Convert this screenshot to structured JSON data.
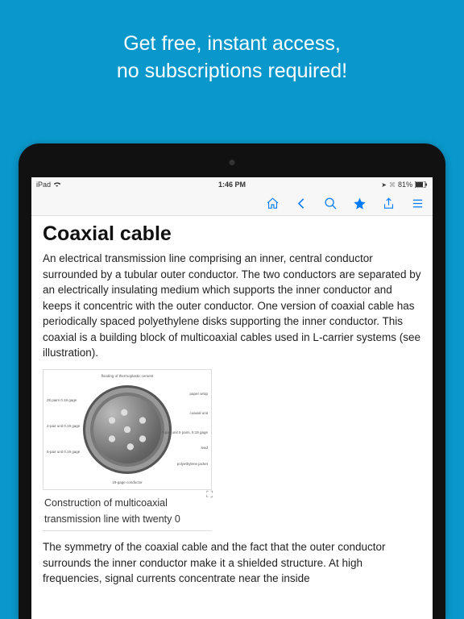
{
  "promo": {
    "line1": "Get free, instant access,",
    "line2": "no subscriptions required!"
  },
  "statusBar": {
    "carrier": "iPad",
    "time": "1:46 PM",
    "battery": "81%"
  },
  "toolbar": {
    "home": "home",
    "back": "back",
    "search": "search",
    "favorite": "favorite",
    "share": "share",
    "menu": "menu"
  },
  "article": {
    "title": "Coaxial cable",
    "para1": "An electrical transmission line comprising an inner, central conductor surrounded by a tubular outer conductor. The two conductors are separated by an electrically insulating medium which supports the inner conductor and keeps it concentric with the outer conductor. One version of coaxial cable has periodically spaced polyethylene disks supporting the inner conductor. This coaxial is a building block of multicoaxial cables used in L-carrier systems (see illustration).",
    "figure": {
      "caption": "Construction of multicoaxial transmission line with twenty 0",
      "labels": {
        "top": "flooding of\nthermoplastic\ncement",
        "l1": "25 pairs\n0.19 gage",
        "l2": "2-pair unit\n0.19 gage",
        "l3": "5-pair unit\n0.19 gage",
        "r1": "paper wrap",
        "r2": "coaxial unit",
        "r3": "7-pair unit\n5 pairs,\n5:19 gage",
        "r4": "lead",
        "r5": "polyethylene\njacket",
        "bot": "19-gage\nconductor"
      }
    },
    "para2": "The symmetry of the coaxial cable and the fact that the outer conductor surrounds the inner conductor make it a shielded structure. At high frequencies, signal currents concentrate near the inside"
  }
}
